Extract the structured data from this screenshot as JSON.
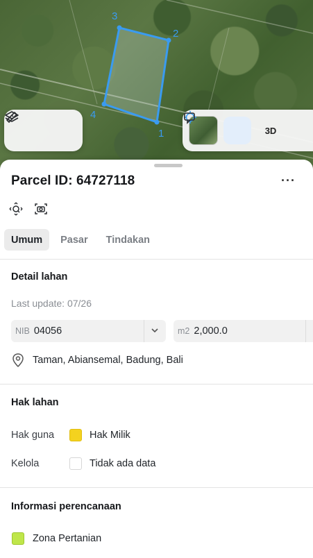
{
  "map": {
    "vertex_labels": [
      "1",
      "2",
      "3",
      "4"
    ],
    "layers_icon": "layers-icon",
    "measure_icon": "ruler-icon",
    "locate_icon": "crosshair-icon",
    "label_3d": "3D",
    "compare_icon": "compare-icon",
    "parcel_color": "#3a9bf0"
  },
  "sheet": {
    "title": "Parcel ID: 64727118",
    "more_label": "···",
    "tabs": [
      {
        "label": "Umum"
      },
      {
        "label": "Pasar"
      },
      {
        "label": "Tindakan"
      }
    ],
    "detail": {
      "heading": "Detail lahan",
      "last_update": "Last update: 07/26",
      "nib_prefix": "NIB",
      "nib_value": "04056",
      "area_prefix": "m2",
      "area_value": "2,000.0",
      "address": "Taman, Abiansemal, Badung, Bali"
    },
    "rights": {
      "heading": "Hak lahan",
      "rows": [
        {
          "label": "Hak guna",
          "value": "Hak Milik",
          "color": "#f4d21f"
        },
        {
          "label": "Kelola",
          "value": "Tidak ada data",
          "color": "#ffffff"
        }
      ]
    },
    "planning": {
      "heading": "Informasi perencanaan",
      "zone": "Zona Pertanian",
      "zone_color": "#bfe64a"
    }
  }
}
